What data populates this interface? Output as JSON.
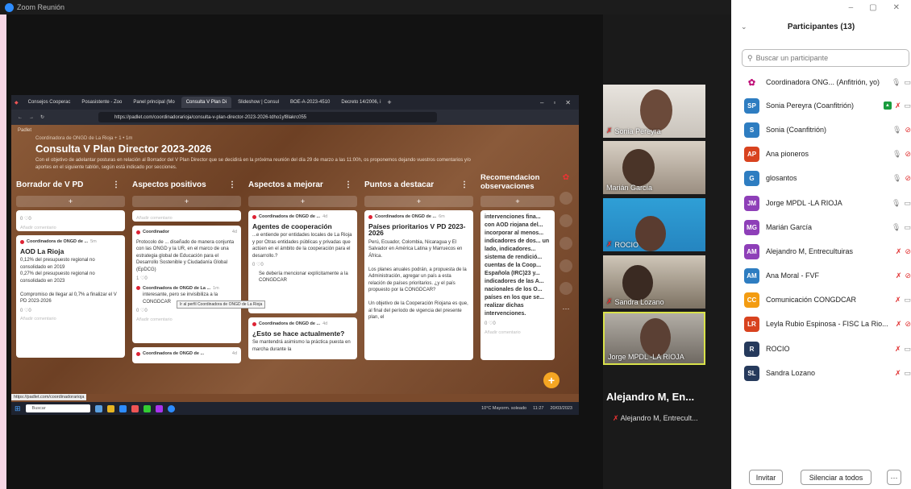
{
  "window": {
    "title": "Zoom Reunión"
  },
  "browser": {
    "tabs": [
      "Consejos Cooperac",
      "Posasistente - Zoo",
      "Panel principal (Mo",
      "Consulta V Plan Di",
      "Slideshow | Consul",
      "BOE-A-2023-4510",
      "Decreto 14/2006, i"
    ],
    "url": "https://padlet.com/coordinadorarioja/consulta-v-plan-director-2023-2026-tdho1yf8lakrc055"
  },
  "padlet": {
    "label": "Padlet",
    "breadcrumb": "Coordinadora de ONGD de La Rioja + 1 • 1m",
    "title": "Consulta V Plan Director 2023-2026",
    "description": "Con el objetivo de adelantar posturas en relación al Borrador del V Plan Director que se decidirá en la próxima reunión del día 29 de marzo a las 11:00h, os proponemos dejando vuestros comentarios y/o aportes en el siguiente tablón, según está indicado por secciones.",
    "columns": [
      {
        "title": "Borrador de V PD",
        "cards": [
          {
            "author": "",
            "meta": "0 ♡0",
            "body": "",
            "comment": "Añadir comentario"
          },
          {
            "author": "Coordinadora de ONGD de ...",
            "time": "5m",
            "title": "AOD La Rioja",
            "body": "0,12% del presupuesto regional no consolidado en 2019\n0,27% del presupuesto regional no consolidado en 2023\n\nCompromiso de llegar al 0,7% a finalizar el V PD 2023-2026",
            "meta": "0 ♡0",
            "comment": "Añadir comentario"
          }
        ]
      },
      {
        "title": "Aspectos positivos",
        "cards": [
          {
            "author": "",
            "meta": "",
            "body": "",
            "comment": "Añadir comentario"
          },
          {
            "author": "Coordinador",
            "time": "4d",
            "title": "",
            "body": "Protocolo de ... diseñado de manera conjunta con las ONGD y la UR, en el marco de una estrategia global de Educación para el Desarrollo Sostenible y Ciudadanía Global (EpDCG)",
            "meta": "1 ♡0",
            "comment": ""
          },
          {
            "author": "Coordinadora de ONGD de La ...",
            "time": "1m",
            "title": "",
            "body": "interesante, pero se invisibiliza a la CONGDCAR",
            "meta": "0 ♡0",
            "comment": "Añadir comentario"
          },
          {
            "author": "Coordinadora de ONGD de ...",
            "time": "4d",
            "title": "",
            "body": "",
            "meta": "",
            "comment": ""
          }
        ]
      },
      {
        "title": "Aspectos a mejorar",
        "cards": [
          {
            "author": "Coordinadora de ONGD de ...",
            "time": "4d",
            "title": "Agentes de cooperación",
            "body": "...e entiende por entidades locales de La Rioja y por Otras entidades públicas y privadas que actúen en el ámbito de la cooperación para el desarrollo.?",
            "meta": "0 ♡0",
            "comment": "Se debería mencionar explícitamente a la CONGDCAR"
          },
          {
            "author": "Coordinadora de ONGD de ...",
            "time": "4d",
            "title": "¿Esto se hace actualmente?",
            "body": "Se mantendrá asimismo la práctica puesta en marcha durante la",
            "meta": "",
            "comment": ""
          }
        ]
      },
      {
        "title": "Puntos a destacar",
        "cards": [
          {
            "author": "Coordinadora de ONGD de ...",
            "time": "6m",
            "title": "Países prioritarios V PD 2023-2026",
            "body": "Perú, Ecuador, Colombia, Nicaragua y El Salvador en América Latina y Marruecos en África.\n\nLos planes anuales podrán, a propuesta de la Administración, agregar un país a esta relación de países prioritarios. ¿y el país propuesto por la CONGDCAR?\n\nUn objetivo de la Cooperación Riojana es que, al final del período de vigencia del presente plan, el",
            "meta": "",
            "comment": ""
          }
        ]
      },
      {
        "title": "Recomendacion observaciones",
        "cards": [
          {
            "author": "",
            "time": "",
            "title": "",
            "body": "intervenciones fina... con AOD riojana del... incorporar al menos... indicadores de dos... un lado, indicadores... sistema de rendició... cuentas de la Coop... Española (IRC)23 y... indicadores de las A... nacionales de los O... países en los que se... realizar dichas intervenciones.",
            "meta": "0 ♡0",
            "comment": "Añadir comentario"
          }
        ]
      }
    ],
    "tooltip": "Ir al perfil Coordinadora de ONGD de La Rioja",
    "status_url": "https://padlet.com/coordinadorarioja"
  },
  "taskbar": {
    "search": "Buscar",
    "weather": "10°C Mayorm. soleado",
    "time": "11:27",
    "date": "20/03/2023"
  },
  "videos": [
    {
      "name": "Sonia Pereyra",
      "muted": true
    },
    {
      "name": "Marián García",
      "muted": false
    },
    {
      "name": "ROCIO",
      "muted": true
    },
    {
      "name": "Sandra Lozano",
      "muted": true
    },
    {
      "name": "Jorge MPDL -LA RIOJA",
      "muted": false
    }
  ],
  "active_speaker": {
    "big": "Alejandro M, En...",
    "small": "Alejandro M, Entrecult..."
  },
  "participants": {
    "header": "Participantes (13)",
    "search_placeholder": "Buscar un participante",
    "list": [
      {
        "initials": "",
        "name": "Coordinadora ONG...  (Anfitrión, yo)",
        "color": "#c0137a"
      },
      {
        "initials": "SP",
        "name": "Sonia Pereyra  (Coanfitrión)",
        "color": "#2e7dc1"
      },
      {
        "initials": "S",
        "name": "Sonia (Coanfitrión)",
        "color": "#2e7dc1"
      },
      {
        "initials": "AP",
        "name": "Ana pioneros",
        "color": "#d8431f"
      },
      {
        "initials": "G",
        "name": "glosantos",
        "color": "#2e7dc1"
      },
      {
        "initials": "JM",
        "name": "Jorge MPDL -LA RIOJA",
        "color": "#8e3fb8"
      },
      {
        "initials": "MG",
        "name": "Marián García",
        "color": "#8e3fb8"
      },
      {
        "initials": "AM",
        "name": "Alejandro M, Entrecultuiras",
        "color": "#8e3fb8"
      },
      {
        "initials": "AM",
        "name": "Ana Moral - FVF",
        "color": "#2e7dc1"
      },
      {
        "initials": "CC",
        "name": "Comunicación CONGDCAR",
        "color": "#f39c12"
      },
      {
        "initials": "LR",
        "name": "Leyla Rubio Espinosa - FISC La Rio...",
        "color": "#d8431f"
      },
      {
        "initials": "R",
        "name": "ROCIO",
        "color": "#263a5c"
      },
      {
        "initials": "SL",
        "name": "Sandra Lozano",
        "color": "#263a5c"
      }
    ],
    "invite": "Invitar",
    "mute_all": "Silenciar a todos",
    "more": "···"
  },
  "colors": {
    "accent": "#2d8cff",
    "muted": "#e03030",
    "speaker_border": "#d9e24a"
  }
}
